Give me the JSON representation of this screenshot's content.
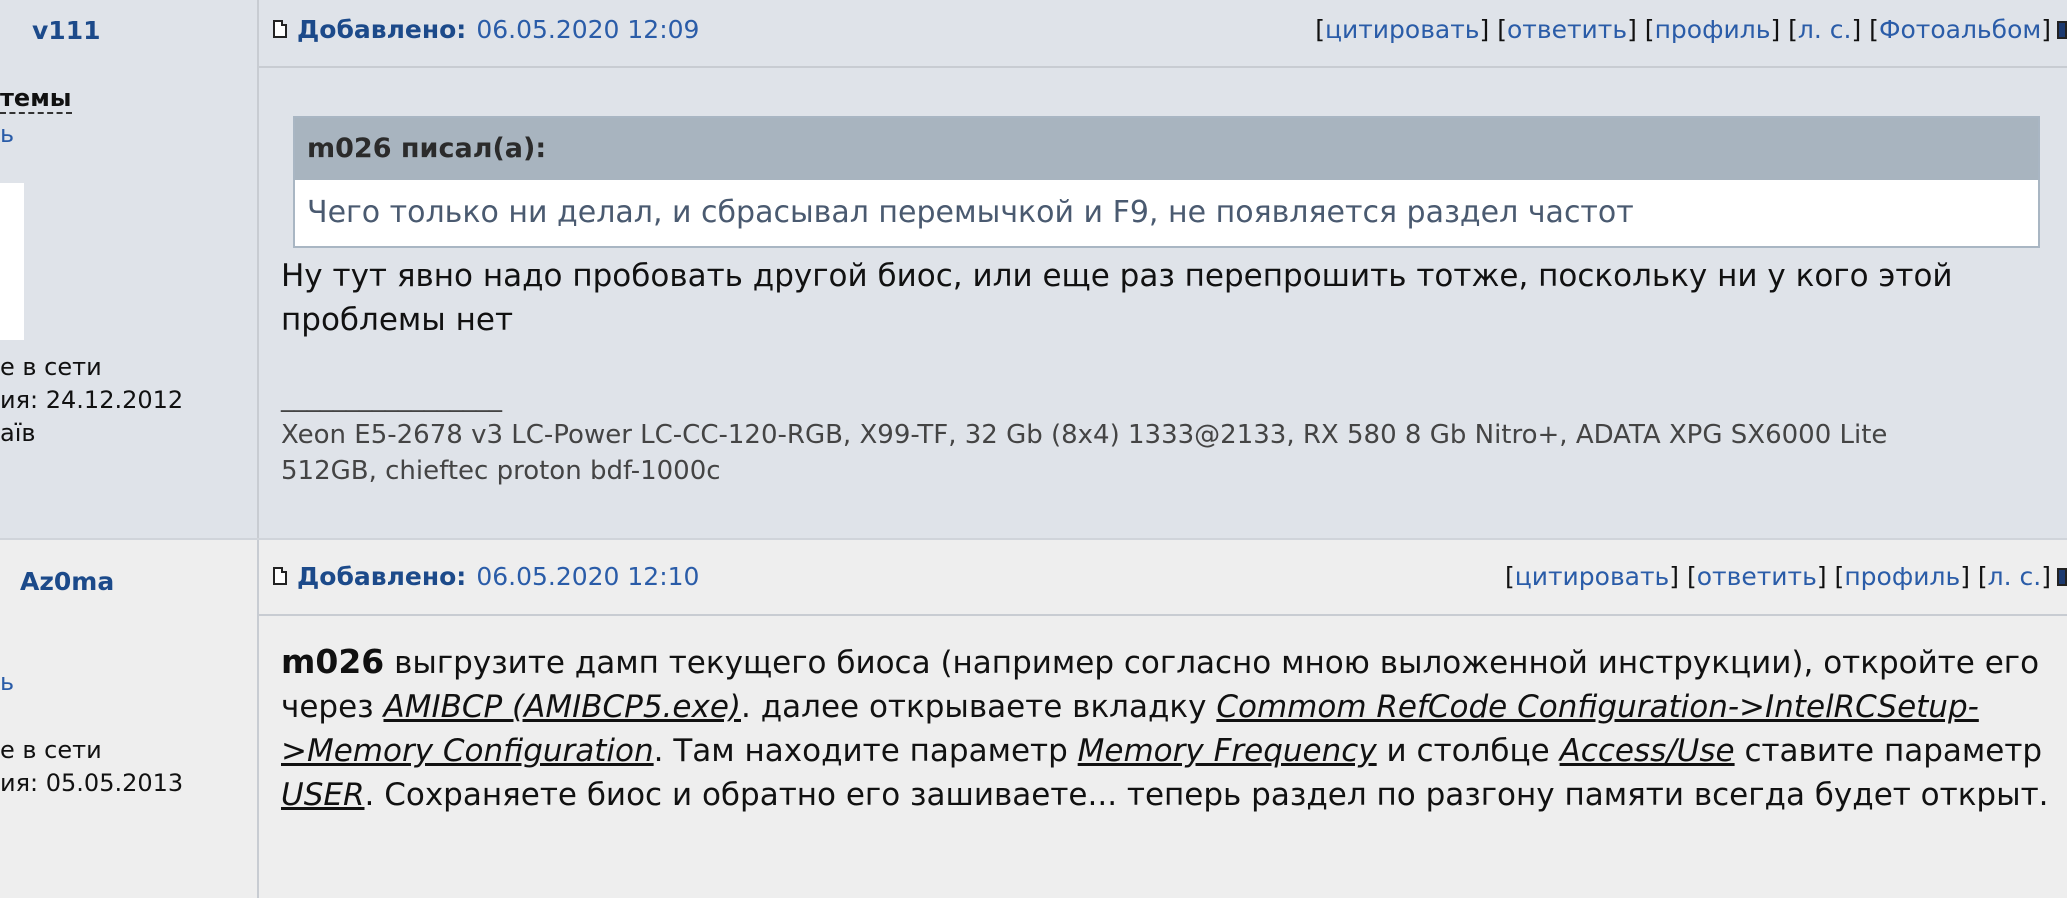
{
  "post1": {
    "username": "v111",
    "side_fragments": [
      "темы",
      "ь",
      "е в сети",
      "ия: 24.12.2012",
      "аїв"
    ],
    "added_label": "Добавлено:",
    "date": "06.05.2020 12:09",
    "actions": [
      "цитировать",
      "ответить",
      "профиль",
      "л. с.",
      "Фотоальбом"
    ],
    "quote_author": "m026 писал(а):",
    "quote_text": "Чего только ни делал, и сбрасывал перемычкой и F9, не появляется раздел частот",
    "message": "Ну тут явно надо пробовать другой биос, или еще раз перепрошить тотже, поскольку ни у кого этой проблемы нет",
    "sig_line": "_________________",
    "signature": "Xeon E5-2678 v3 LC-Power LC-CC-120-RGB, X99-TF, 32 Gb (8x4) 1333@2133, RX 580 8 Gb Nitro+, ADATA XPG SX6000 Lite 512GB, chieftec proton bdf-1000c"
  },
  "post2": {
    "username": "Az0ma",
    "side_fragments": [
      "ь",
      "е в сети",
      "ия: 05.05.2013"
    ],
    "added_label": "Добавлено:",
    "date": "06.05.2020 12:10",
    "actions": [
      "цитировать",
      "ответить",
      "профиль",
      "л. с."
    ],
    "msg_bold": "m026",
    "msg_t1": " выгрузите дамп текущего биоса (например согласно мною выложенной инструкции), откройте его через ",
    "msg_l1": "AMIBCP (AMIBCP5.exe)",
    "msg_t2": ". далее открываете вкладку ",
    "msg_l2": "Commom RefCode Configuration->IntelRCSetup->Memory Configuration",
    "msg_t3": ". Там находите параметр ",
    "msg_l3": "Memory Frequency",
    "msg_t4": " и столбце ",
    "msg_l4": "Access/Use",
    "msg_t5": " ставите параметр ",
    "msg_l5": "USER",
    "msg_t6": ". Сохраняете биос и обратно его зашиваете... теперь раздел по разгону памяти всегда будет открыт."
  },
  "colors": {
    "accent": "#1c4a8a",
    "link": "#2a5ca8",
    "quote_header": "#a8b4bf"
  }
}
